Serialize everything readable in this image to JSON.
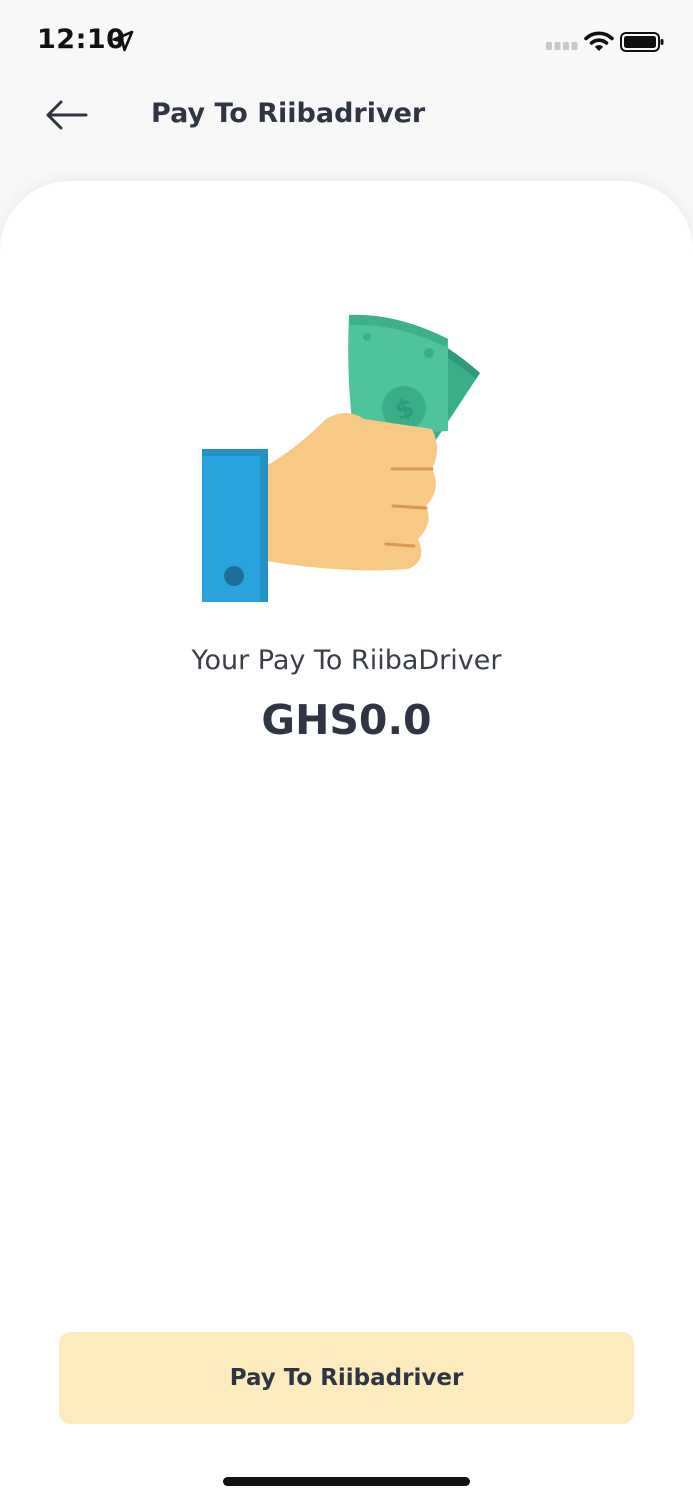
{
  "status_bar": {
    "time": "12:10",
    "icons": [
      "location-arrow-icon",
      "cellular-signal-icon",
      "wifi-icon",
      "battery-icon"
    ]
  },
  "header": {
    "back_icon": "arrow-left-icon",
    "title": "Pay To Riibadriver"
  },
  "main": {
    "illustration": "hand-holding-cash-icon",
    "pay_label": "Your Pay To RiibaDriver",
    "amount": "GHS0.0"
  },
  "footer": {
    "pay_button_label": "Pay To Riibadriver"
  },
  "colors": {
    "background": "#f8f8f8",
    "card": "#ffffff",
    "button": "#fcebbc",
    "text": "#2f3542",
    "sleeve": "#29a3dc",
    "skin": "#f7c985",
    "money": "#4fc39b"
  }
}
